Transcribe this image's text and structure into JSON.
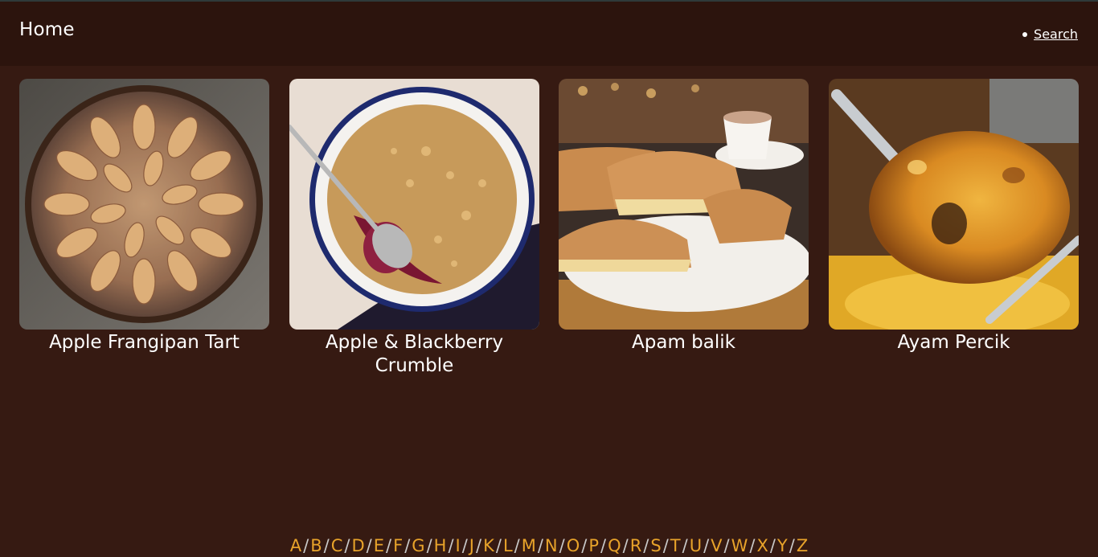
{
  "navbar": {
    "brand": "Home",
    "search_label": "Search"
  },
  "recipes": [
    {
      "title": "Apple Frangipan Tart",
      "image": "apple-tart-photo"
    },
    {
      "title": "Apple & Blackberry Crumble",
      "image": "crumble-photo"
    },
    {
      "title": "Apam balik",
      "image": "apam-balik-photo"
    },
    {
      "title": "Ayam Percik",
      "image": "ayam-percik-photo"
    }
  ],
  "alphabet": [
    "A",
    "B",
    "C",
    "D",
    "E",
    "F",
    "G",
    "H",
    "I",
    "J",
    "K",
    "L",
    "M",
    "N",
    "O",
    "P",
    "Q",
    "R",
    "S",
    "T",
    "U",
    "V",
    "W",
    "X",
    "Y",
    "Z"
  ],
  "colors": {
    "background": "#361a12",
    "navbar": "#2c140d",
    "link": "#e8a32a",
    "text": "#ffffff"
  }
}
